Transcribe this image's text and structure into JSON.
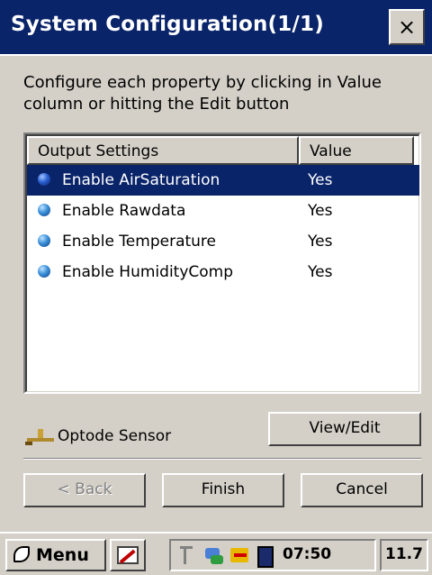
{
  "window": {
    "title": "System Configuration(1/1)",
    "close_label": "×",
    "instructions": "Configure each property by clicking in Value column or hitting the Edit button"
  },
  "list": {
    "columns": [
      "Output Settings",
      "Value"
    ],
    "rows": [
      {
        "name": "Enable AirSaturation",
        "value": "Yes",
        "selected": true
      },
      {
        "name": "Enable Rawdata",
        "value": "Yes",
        "selected": false
      },
      {
        "name": "Enable Temperature",
        "value": "Yes",
        "selected": false
      },
      {
        "name": "Enable HumidityComp",
        "value": "Yes",
        "selected": false
      }
    ]
  },
  "sensor": {
    "label": "Optode Sensor",
    "icon": "sensor-icon"
  },
  "buttons": {
    "view_edit": "View/Edit",
    "back": "< Back",
    "finish": "Finish",
    "cancel": "Cancel"
  },
  "taskbar": {
    "menu_label": "Menu",
    "clock": "07:50",
    "version": "11.7"
  },
  "colors": {
    "titlebar": "#0a246a",
    "selection": "#0a246a",
    "face": "#d4d0c8"
  }
}
